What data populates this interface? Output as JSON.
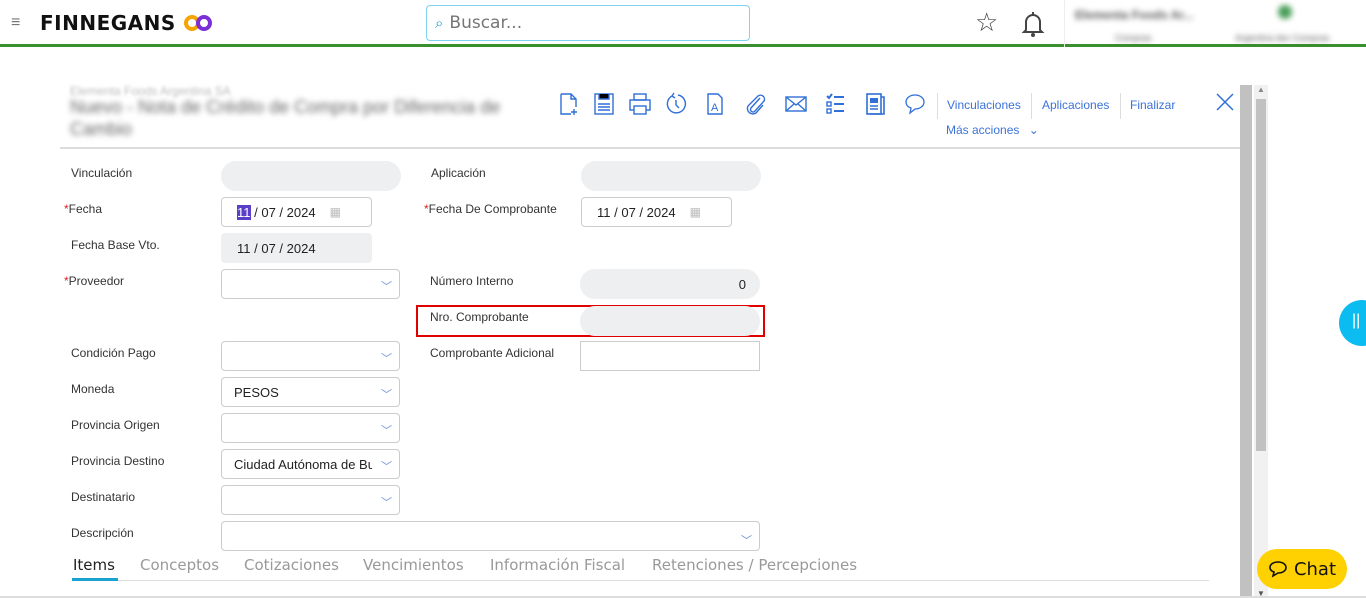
{
  "header": {
    "brand": "FINNEGANS",
    "search_placeholder": "Buscar...",
    "company_blurred": "Elementa Foods Ar...",
    "sub1_blurred": "Compras",
    "sub2_blurred": "Argentina dev Compras"
  },
  "doc": {
    "company": "Elementa Foods Argentina SA",
    "title": "Nuevo - Nota de Crédito de Compra por Diferencia de Cambio"
  },
  "toolbar": {
    "icons": [
      "new-document",
      "save",
      "print",
      "history",
      "text-document",
      "attach",
      "email",
      "checklist",
      "report",
      "comment"
    ],
    "vinculaciones": "Vinculaciones",
    "aplicaciones": "Aplicaciones",
    "finalizar": "Finalizar",
    "mas_acciones": "Más acciones"
  },
  "form": {
    "vinculacion": {
      "label": "Vinculación",
      "value": ""
    },
    "aplicacion": {
      "label": "Aplicación",
      "value": ""
    },
    "fecha": {
      "label": "Fecha",
      "day": "11",
      "month": "07",
      "year": "2024",
      "required": "*"
    },
    "fecha_comprobante": {
      "label": "Fecha De Comprobante",
      "day": "11",
      "month": "07",
      "year": "2024",
      "required": "*"
    },
    "fecha_base": {
      "label": "Fecha Base Vto.",
      "day": "11",
      "month": "07",
      "year": "2024"
    },
    "proveedor": {
      "label": "Proveedor",
      "value": "",
      "required": "*"
    },
    "numero_interno": {
      "label": "Número Interno",
      "value": "0"
    },
    "nro_comprobante": {
      "label": "Nro. Comprobante",
      "value": ""
    },
    "condicion_pago": {
      "label": "Condición Pago",
      "value": ""
    },
    "comprobante_adicional": {
      "label": "Comprobante Adicional",
      "value": ""
    },
    "moneda": {
      "label": "Moneda",
      "value": "PESOS"
    },
    "provincia_origen": {
      "label": "Provincia Origen",
      "value": ""
    },
    "provincia_destino": {
      "label": "Provincia Destino",
      "value": "Ciudad Autónoma de Bu"
    },
    "destinatario": {
      "label": "Destinatario",
      "value": ""
    },
    "descripcion": {
      "label": "Descripción",
      "value": ""
    }
  },
  "tabs": [
    {
      "label": "Items",
      "active": true
    },
    {
      "label": "Conceptos"
    },
    {
      "label": "Cotizaciones"
    },
    {
      "label": "Vencimientos"
    },
    {
      "label": "Información Fiscal"
    },
    {
      "label": "Retenciones / Percepciones"
    }
  ],
  "chat": {
    "label": "Chat"
  },
  "colors": {
    "accent": "#3b73d9",
    "header_line": "#3a8f2e",
    "chat": "#ffd100",
    "tab_underline": "#1aa3d0",
    "highlight": "#e00000"
  }
}
